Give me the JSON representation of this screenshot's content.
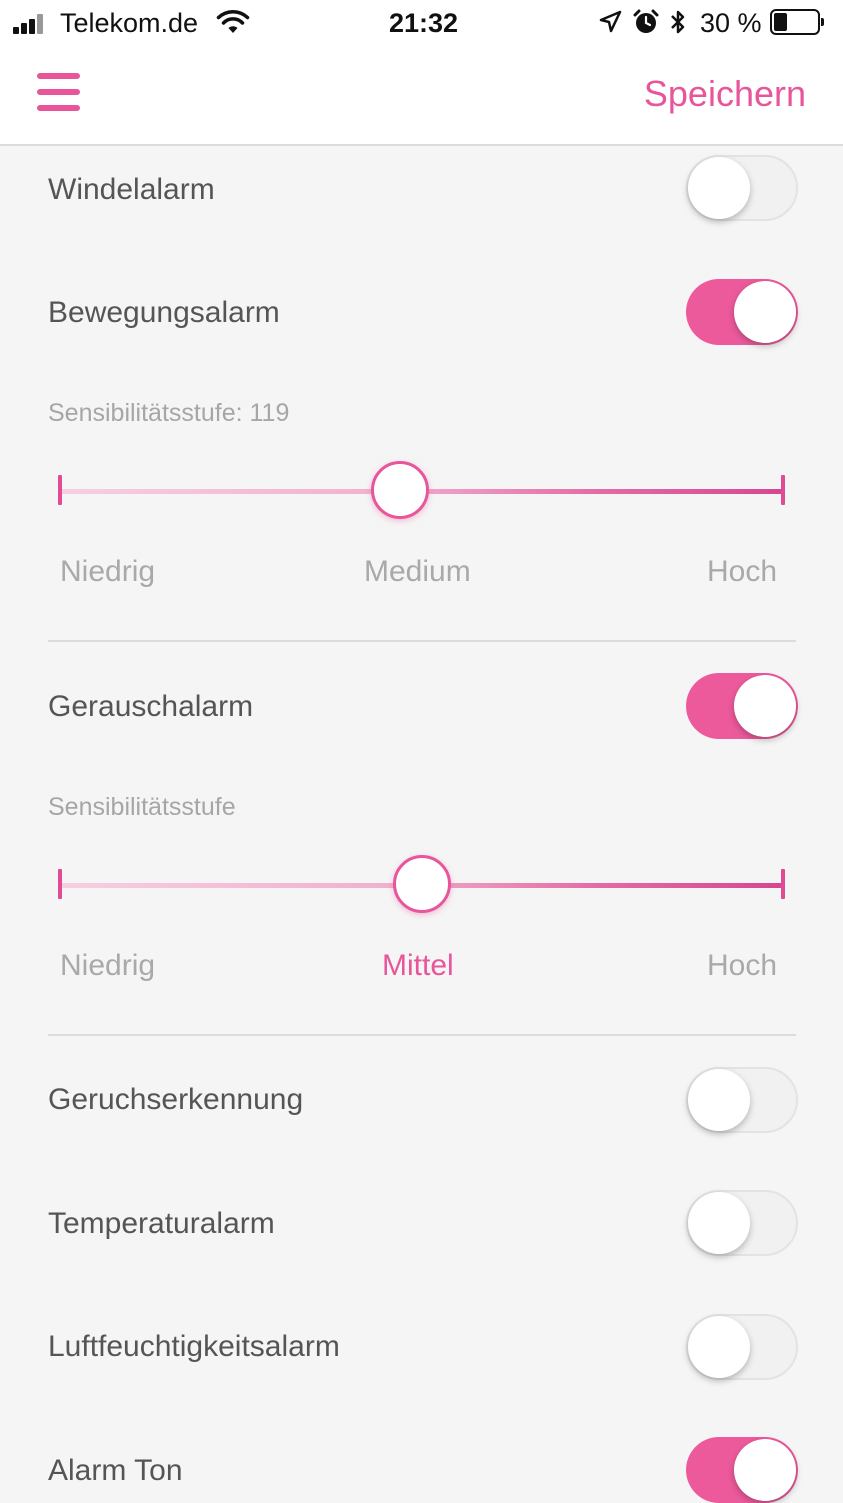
{
  "status_bar": {
    "carrier": "Telekom.de",
    "time": "21:32",
    "battery": "30 %",
    "battery_level_percent": 30,
    "icons": [
      "signal-icon",
      "wifi-icon",
      "location-icon",
      "alarm-clock-icon",
      "bluetooth-icon",
      "battery-icon"
    ]
  },
  "nav": {
    "menu_icon": "hamburger-menu-icon",
    "save_label": "Speichern"
  },
  "colors": {
    "accent": "#e8559a",
    "toggle_on": "#ec5a9c",
    "toggle_off": "#f1f1f1",
    "background": "#f5f5f5"
  },
  "settings": {
    "windelalarm": {
      "label": "Windelalarm",
      "enabled": false
    },
    "bewegungsalarm": {
      "label": "Bewegungsalarm",
      "enabled": true,
      "sensitivity_label": "Sensibilitätsstufe: 119",
      "slider_value_fraction": 0.47,
      "scale": [
        "Niedrig",
        "Medium",
        "Hoch"
      ]
    },
    "gerauschalarm": {
      "label": "Gerauschalarm",
      "enabled": true,
      "sensitivity_label": "Sensibilitätsstufe",
      "slider_value_fraction": 0.5,
      "scale": [
        "Niedrig",
        "Mittel",
        "Hoch"
      ],
      "selected_scale": "Mittel"
    },
    "geruchserkennung": {
      "label": "Geruchserkennung",
      "enabled": false
    },
    "temperaturalarm": {
      "label": "Temperaturalarm",
      "enabled": false
    },
    "luftfeuchtigkeitsalarm": {
      "label": "Luftfeuchtigkeitsalarm",
      "enabled": false
    },
    "alarm_ton": {
      "label": "Alarm Ton",
      "enabled": true
    }
  }
}
